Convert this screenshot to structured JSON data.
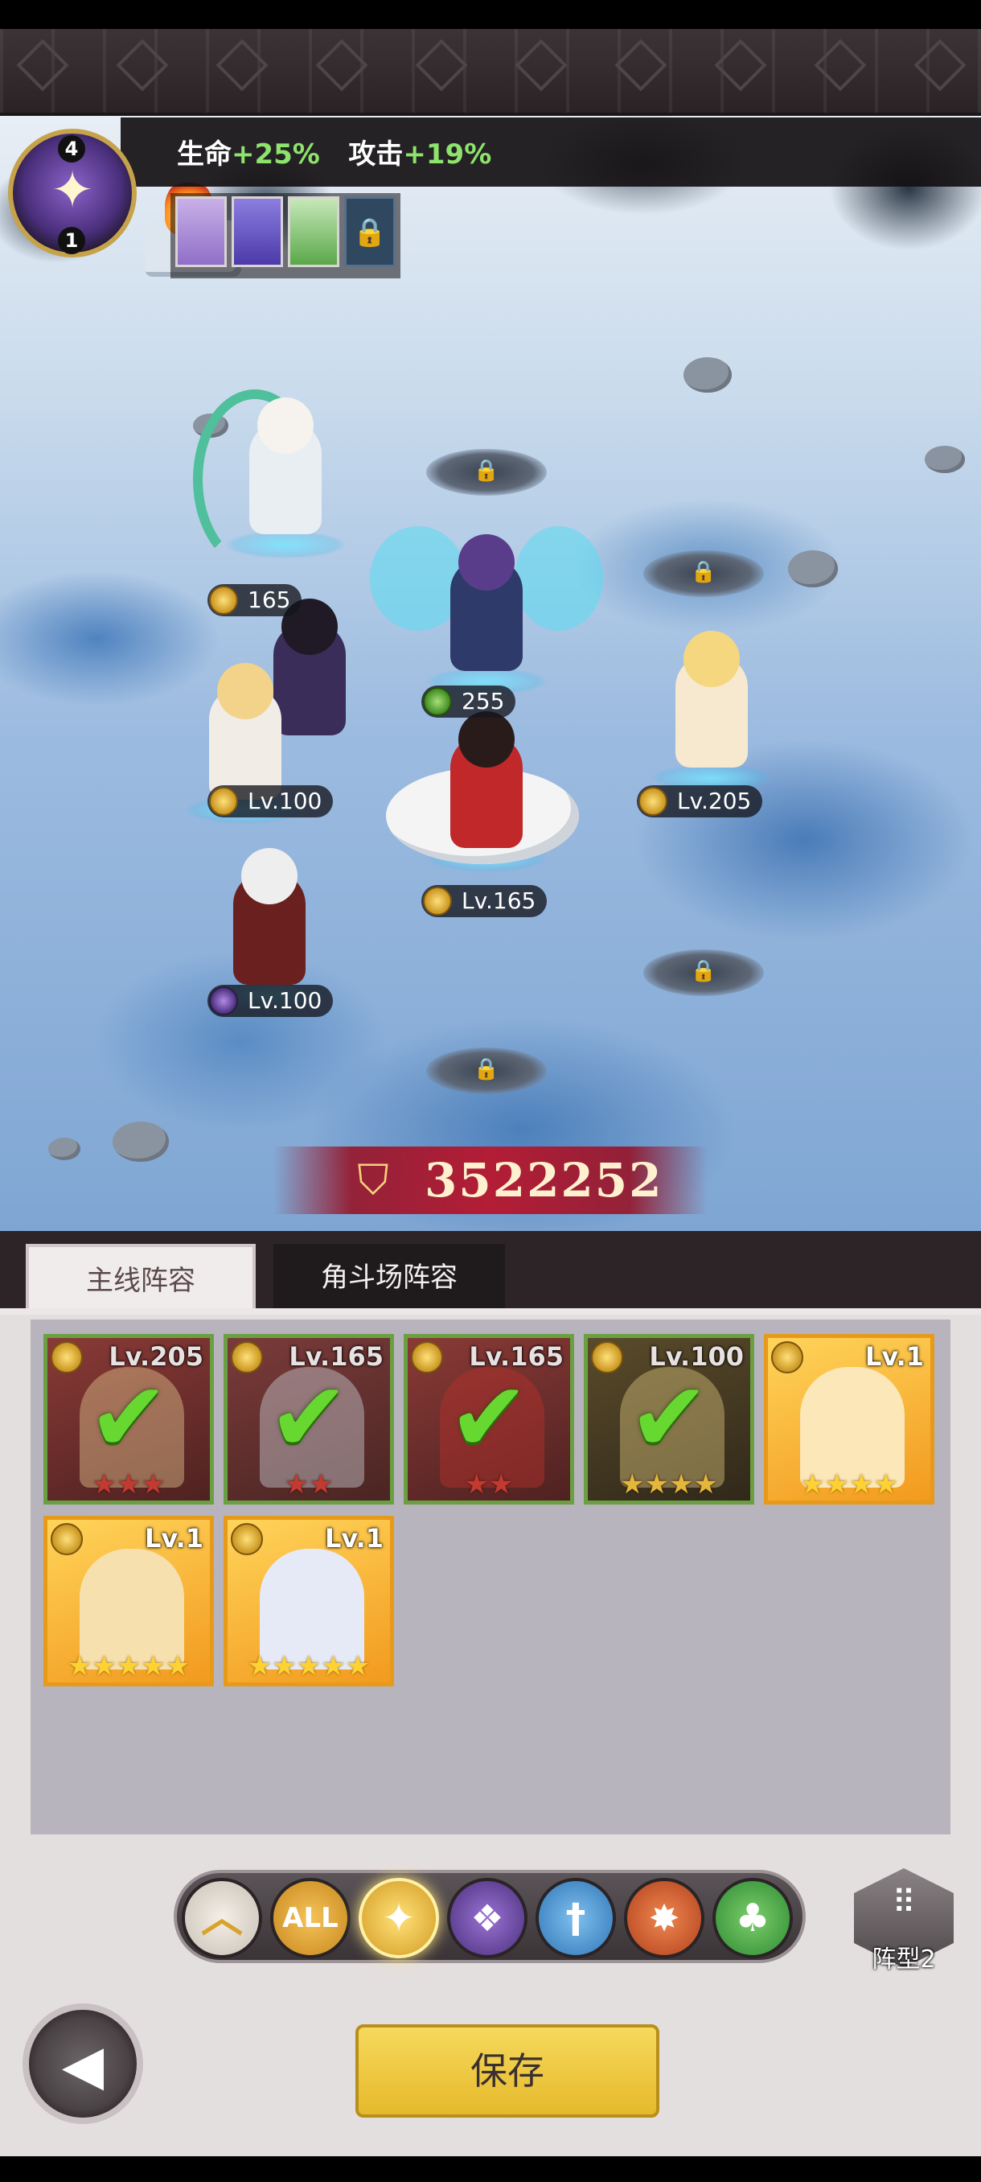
{
  "bonus": {
    "hp_label": "生命",
    "hp_value": "+25%",
    "atk_label": "攻击",
    "atk_value": "+19%"
  },
  "emblem": {
    "top_number": "4",
    "bottom_number": "1"
  },
  "pets": [
    "cat-pet",
    "purple-fox-pet",
    "flower-pet",
    "locked-slot"
  ],
  "heroes": [
    {
      "level": "165",
      "name_key": "angel-moon"
    },
    {
      "level": "255",
      "name_key": "fairy-spear"
    },
    {
      "level": "Lv.100",
      "name_key": "archer-blonde"
    },
    {
      "level": "Lv.205",
      "name_key": "holy-knight"
    },
    {
      "level": "Lv.165",
      "name_key": "crane-rider"
    },
    {
      "level": "Lv.100",
      "name_key": "demon-warrior"
    }
  ],
  "power": "3522252",
  "tabs": {
    "main": "主线阵容",
    "arena": "角斗场阵容"
  },
  "roster": [
    {
      "level": "Lv.205",
      "selected": true,
      "stars": "★★★"
    },
    {
      "level": "Lv.165",
      "selected": true,
      "stars": "★★"
    },
    {
      "level": "Lv.165",
      "selected": true,
      "stars": "★★"
    },
    {
      "level": "Lv.100",
      "selected": true,
      "stars": "★★★★"
    },
    {
      "level": "Lv.1",
      "selected": false,
      "stars": "★★★★"
    },
    {
      "level": "Lv.1",
      "selected": false,
      "stars": "★★★★★"
    },
    {
      "level": "Lv.1",
      "selected": false,
      "stars": "★★★★★"
    }
  ],
  "filters": {
    "all_label": "ALL",
    "items": [
      "up-arrow",
      "all",
      "light",
      "dark",
      "water",
      "fire",
      "nature"
    ],
    "selected": "light"
  },
  "formation_label": "阵型2",
  "save_label": "保存",
  "colors": {
    "accent_gold": "#e6b92b",
    "check_green": "#66d830",
    "bonus_green": "#8de36c"
  }
}
